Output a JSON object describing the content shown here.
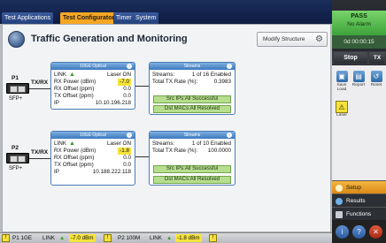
{
  "tabs": [
    {
      "label": "Test Applications"
    },
    {
      "label": "Test Configurator"
    },
    {
      "label": "Timer"
    },
    {
      "label": "System"
    }
  ],
  "page": {
    "title": "Traffic Generation and Monitoring",
    "modify_label": "Modify Structure"
  },
  "ports": [
    {
      "name": "P1",
      "direction": "TX/RX",
      "module": "SFP+",
      "phy": {
        "title": "10GE Optical",
        "link_label": "LINK",
        "laser_label": "Laser ON",
        "rx_power_label": "RX Power (dBm)",
        "rx_power": "-7.0",
        "rx_offset_label": "RX Offset (ppm)",
        "rx_offset": "0.0",
        "tx_offset_label": "TX Offset (ppm)",
        "tx_offset": "0.0",
        "ip_label": "IP",
        "ip": "10.10.196.218"
      },
      "streams": {
        "title": "Streams",
        "streams_label": "Streams:",
        "streams_value": "1 of 16 Enabled",
        "rate_label": "Total TX Rate (%):",
        "rate_value": "0.3983",
        "src_ips": "Src IPs:All Successful",
        "dst_macs": "Dst MACs:All Resolved"
      }
    },
    {
      "name": "P2",
      "direction": "TX/RX",
      "module": "SFP+",
      "phy": {
        "title": "10GE Optical",
        "link_label": "LINK",
        "laser_label": "Laser ON",
        "rx_power_label": "RX Power (dBm)",
        "rx_power": "-1.8",
        "rx_offset_label": "RX Offset (ppm)",
        "rx_offset": "0.0",
        "tx_offset_label": "TX Offset (ppm)",
        "tx_offset": "0.0",
        "ip_label": "IP",
        "ip": "10.188.222.118"
      },
      "streams": {
        "title": "Streams",
        "streams_label": "Streams:",
        "streams_value": "1 of 10 Enabled",
        "rate_label": "Total TX Rate (%):",
        "rate_value": "100.0000",
        "src_ips": "Src IPs:All Successful",
        "dst_macs": "Dst MACs:All Resolved"
      }
    }
  ],
  "right_panel": {
    "status": "PASS",
    "alarm": "No Alarm",
    "timer": "0d 00:00:15",
    "stop_label": "Stop",
    "tx_label": "TX",
    "tools": [
      {
        "label": "Save\nLoad",
        "icon": "save-icon"
      },
      {
        "label": "Report",
        "icon": "report-icon"
      },
      {
        "label": "Reset",
        "icon": "reset-icon"
      }
    ],
    "laser_label": "Laser",
    "nav": [
      {
        "label": "Setup"
      },
      {
        "label": "Results"
      },
      {
        "label": "Functions"
      }
    ]
  },
  "status_bar": {
    "p1_label": "P1 1GE",
    "p1_link": "LINK",
    "p1_power": "-7.0 dBm",
    "p2_label": "P2 100M",
    "p2_link": "LINK",
    "p2_power": "-1.8 dBm"
  },
  "colors": {
    "accent": "#f5a623",
    "pass": "#5cc04f",
    "card_header": "#3c78be",
    "success": "#b7de8e"
  }
}
